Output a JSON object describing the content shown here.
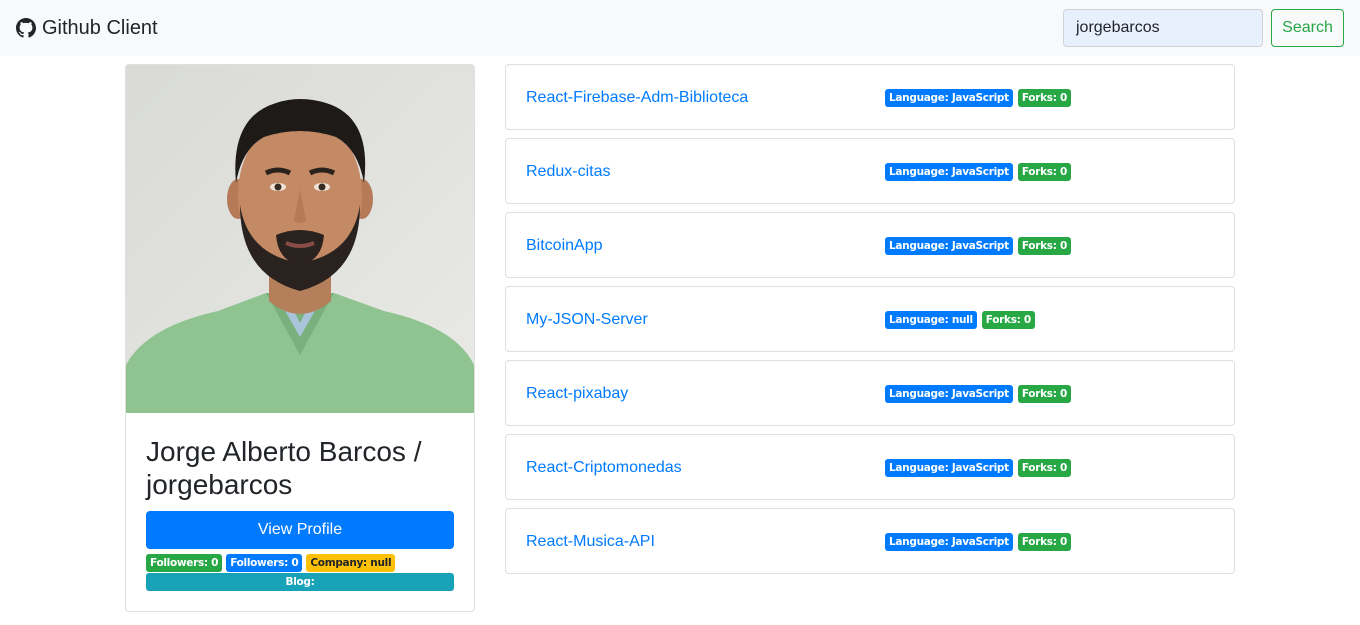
{
  "navbar": {
    "brand": "Github Client",
    "search_value": "jorgebarcos",
    "search_button": "Search"
  },
  "profile": {
    "name": "Jorge Alberto Barcos / jorgebarcos",
    "view_profile": "View Profile",
    "followers_badge": "Followers: 0",
    "following_badge": "Followers: 0",
    "company_badge": "Company: null",
    "blog_badge": "Blog:"
  },
  "repos": [
    {
      "name": "React-Firebase-Adm-Biblioteca",
      "language": "Language: JavaScript",
      "forks": "Forks: 0"
    },
    {
      "name": "Redux-citas",
      "language": "Language: JavaScript",
      "forks": "Forks: 0"
    },
    {
      "name": "BitcoinApp",
      "language": "Language: JavaScript",
      "forks": "Forks: 0"
    },
    {
      "name": "My-JSON-Server",
      "language": "Language: null",
      "forks": "Forks: 0"
    },
    {
      "name": "React-pixabay",
      "language": "Language: JavaScript",
      "forks": "Forks: 0"
    },
    {
      "name": "React-Criptomonedas",
      "language": "Language: JavaScript",
      "forks": "Forks: 0"
    },
    {
      "name": "React-Musica-API",
      "language": "Language: JavaScript",
      "forks": "Forks: 0"
    }
  ],
  "icons": {
    "brand": "github-icon"
  },
  "colors": {
    "primary": "#007bff",
    "success": "#28a745",
    "warning": "#ffc107",
    "info": "#17a2b8"
  }
}
